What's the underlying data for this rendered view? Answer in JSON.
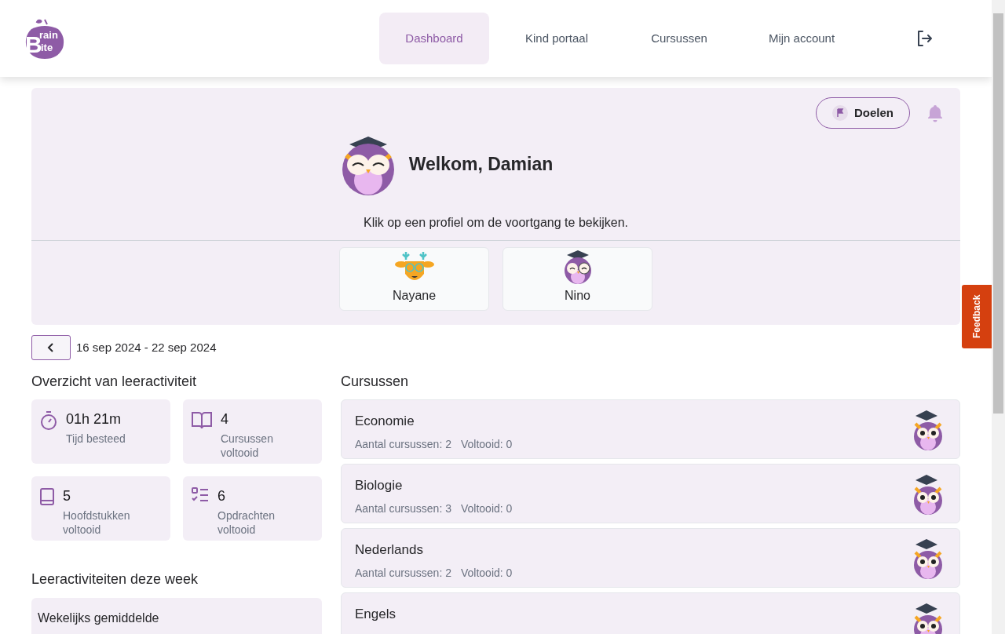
{
  "logo": {
    "parts": [
      "B",
      "rain",
      "ite"
    ]
  },
  "nav": [
    {
      "label": "Dashboard",
      "selected": true
    },
    {
      "label": "Kind portaal",
      "selected": false
    },
    {
      "label": "Cursussen",
      "selected": false
    },
    {
      "label": "Mijn account",
      "selected": false
    }
  ],
  "goals_button": "Doelen",
  "welcome": {
    "title": "Welkom, Damian",
    "subtitle": "Klik op een profiel om de voortgang te bekijken."
  },
  "profiles": [
    {
      "name": "Nayane",
      "kind": "deer"
    },
    {
      "name": "Nino",
      "kind": "owl"
    }
  ],
  "date_range": "16 sep 2024 - 22 sep 2024",
  "overview": {
    "title": "Overzicht van leeractiviteit",
    "stats": [
      {
        "kind": "time",
        "value": "01h 21m",
        "label": "Tijd besteed"
      },
      {
        "kind": "courses",
        "value": "4",
        "label": "Cursussen voltooid"
      },
      {
        "kind": "chapters",
        "value": "5",
        "label": "Hoofdstukken voltooid"
      },
      {
        "kind": "assignments",
        "value": "6",
        "label": "Opdrachten voltooid"
      }
    ]
  },
  "week": {
    "title": "Leeractiviteiten deze week",
    "card_title": "Wekelijks gemiddelde"
  },
  "courses": {
    "title": "Cursussen",
    "items": [
      {
        "name": "Economie",
        "count": "Aantal cursussen: 2",
        "done": "Voltooid: 0"
      },
      {
        "name": "Biologie",
        "count": "Aantal cursussen: 3",
        "done": "Voltooid: 0"
      },
      {
        "name": "Nederlands",
        "count": "Aantal cursussen: 2",
        "done": "Voltooid: 0"
      },
      {
        "name": "Engels"
      }
    ]
  },
  "feedback_tab": "Feedback"
}
